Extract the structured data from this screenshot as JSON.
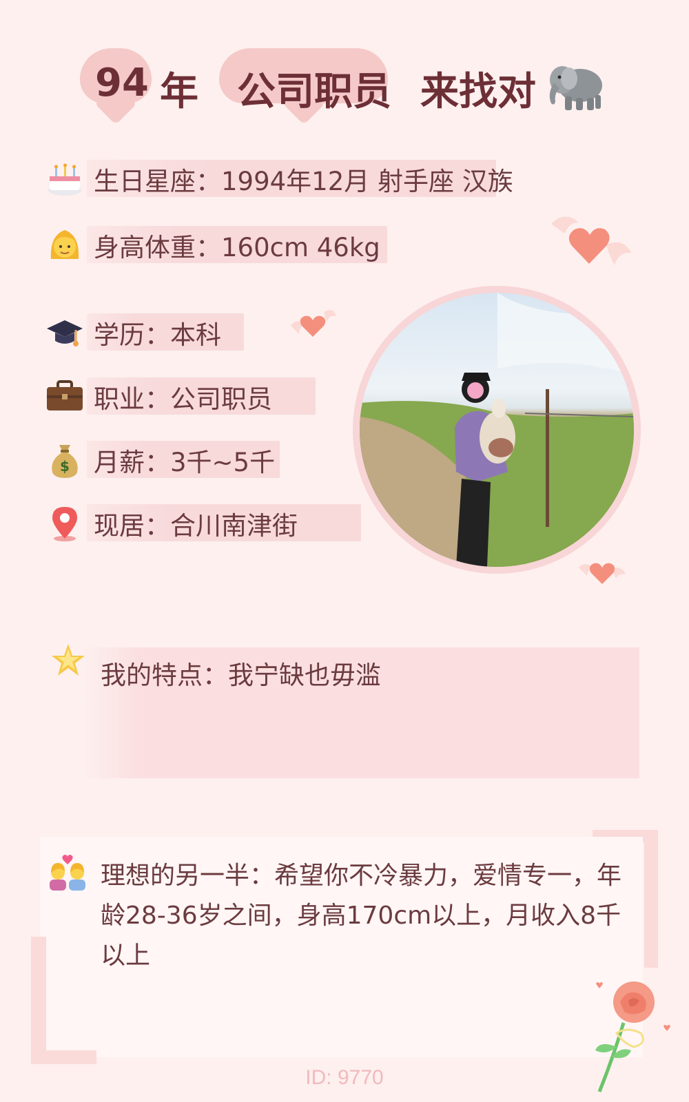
{
  "header": {
    "age_value": "94",
    "age_unit": "年",
    "occupation": "公司职员",
    "cta": "来找对"
  },
  "rows": [
    {
      "icon": "birthday-cake-icon",
      "text": "生日星座：1994年12月 射手座 汉族"
    },
    {
      "icon": "woman-icon",
      "text": "身高体重：160cm 46kg"
    },
    {
      "icon": "graduation-cap-icon",
      "text": "学历：本科"
    },
    {
      "icon": "briefcase-icon",
      "text": "职业：公司职员"
    },
    {
      "icon": "money-bag-icon",
      "text": "月薪：3千~5千"
    },
    {
      "icon": "location-pin-icon",
      "text": "现居：合川南津街"
    }
  ],
  "feature": {
    "icon": "star-icon",
    "text": "我的特点：我宁缺也毋滥"
  },
  "ideal": {
    "icon": "couple-heart-icon",
    "text": "理想的另一半：希望你不冷暴力，爱情专一，年龄28-36岁之间，身高170cm以上，月收入8千以上"
  },
  "footer": {
    "id": "ID: 9770"
  },
  "colors": {
    "background": "#fdf0ef",
    "accent": "#f8dadb",
    "text": "#6b3b3f",
    "title": "#6d2f36"
  }
}
